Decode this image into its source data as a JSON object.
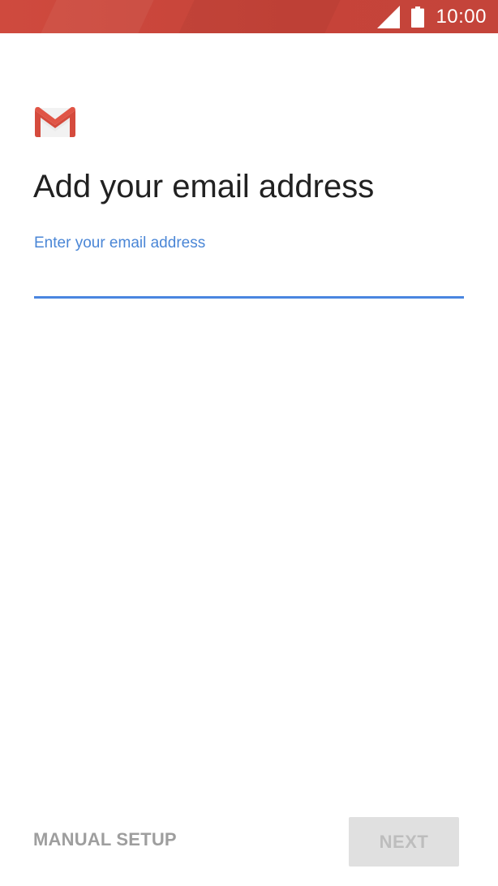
{
  "status_bar": {
    "time": "10:00",
    "signal_icon": "signal-icon",
    "battery_icon": "battery-icon",
    "color": "#c8453a"
  },
  "header": {
    "logo_icon": "gmail-logo-icon",
    "title": "Add your email address"
  },
  "email_field": {
    "label": "Enter your email address",
    "value": "",
    "accent_color": "#4a86e0"
  },
  "footer": {
    "manual_setup_label": "MANUAL SETUP",
    "next_label": "NEXT"
  }
}
